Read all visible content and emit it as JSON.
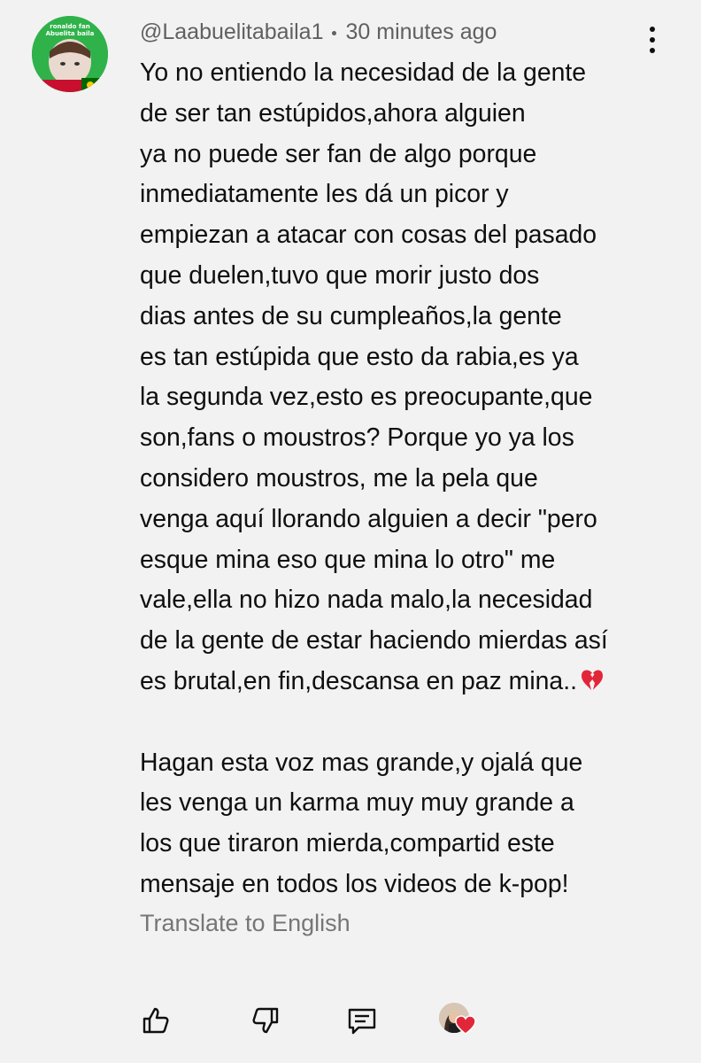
{
  "comment": {
    "username": "@Laabuelitabaila1",
    "timestamp": "30 minutes ago",
    "avatar_text": [
      "ronaldo fan",
      "Abuelita baila"
    ],
    "lines": [
      "Yo no entiendo la necesidad de la gente",
      "de ser tan estúpidos,ahora alguien",
      "ya no puede ser fan de algo porque",
      "inmediatamente les dá un picor y",
      "empiezan a atacar con cosas del pasado",
      "que duelen,tuvo que morir justo dos",
      "dias antes de su cumpleaños,la gente",
      "es tan estúpida que esto da rabia,es ya",
      "la segunda vez,esto es preocupante,que",
      "son,fans o moustros? Porque yo ya los",
      "considero moustros, me la pela que",
      "venga aquí llorando alguien a decir \"pero",
      "esque mina eso que mina lo otro\" me",
      "vale,ella no hizo nada malo,la necesidad",
      "de la gente de estar haciendo mierdas así",
      "es brutal,en fin,descansa en paz mina..",
      "",
      "Hagan esta voz mas grande,y ojalá que",
      "les venga un karma muy muy grande a",
      "los que tiraron mierda,compartid este",
      "mensaje en todos los videos de k-pop!"
    ],
    "emoji_after_line_16": "broken-heart-icon",
    "translate_label": "Translate to English"
  },
  "actions": {
    "icons": [
      "thumbs-up-icon",
      "thumbs-down-icon",
      "reply-icon",
      "creator-heart-icon"
    ]
  },
  "colors": {
    "background": "#f2f2f2",
    "text": "#0f0f0f",
    "secondary_text": "#606060",
    "avatar_green": "#2fb24a",
    "heart_red": "#e2263a"
  }
}
